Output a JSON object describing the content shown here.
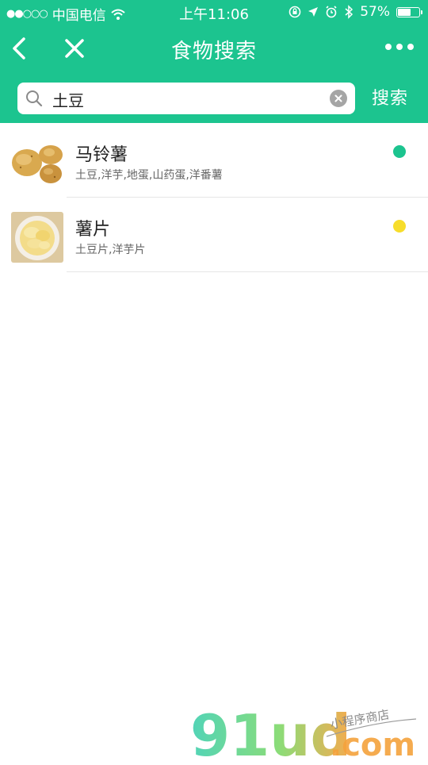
{
  "status_bar": {
    "signal": "●●○○○",
    "carrier": "中国电信",
    "time": "上午11:06",
    "battery": "57%",
    "battery_level": 0.57
  },
  "nav": {
    "title": "食物搜索"
  },
  "search": {
    "query": "土豆",
    "button_label": "搜索"
  },
  "results": [
    {
      "name": "马铃薯",
      "aliases": "土豆,洋芋,地蛋,山药蛋,洋番薯",
      "dot_color": "#1cc48f",
      "image": "potato-image"
    },
    {
      "name": "薯片",
      "aliases": "土豆片,洋芋片",
      "dot_color": "#f7dd2b",
      "image": "potato-chips-image"
    }
  ],
  "watermark": {
    "logo": "91ud.com",
    "tagline": "小程序商店"
  },
  "colors": {
    "brand": "#1cc48f"
  }
}
